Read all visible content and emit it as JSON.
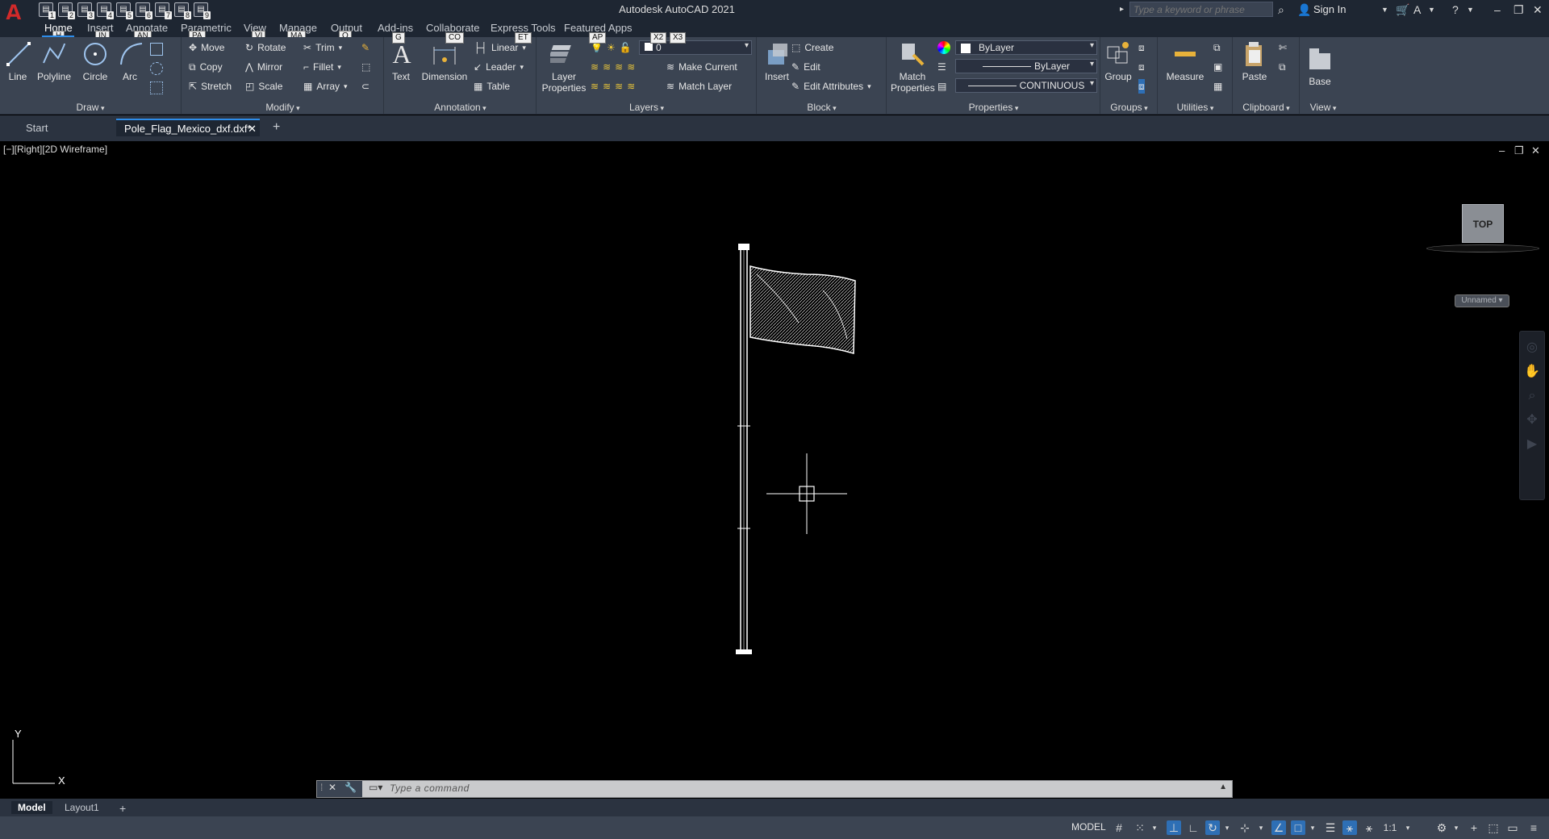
{
  "app": {
    "title": "Autodesk AutoCAD 2021",
    "logo": "A",
    "search_placeholder": "Type a keyword or phrase",
    "sign_in": "Sign In"
  },
  "qat": [
    {
      "glyph": "▤",
      "keytip": "1"
    },
    {
      "glyph": "▤",
      "keytip": "2"
    },
    {
      "glyph": "▤",
      "keytip": "3"
    },
    {
      "glyph": "▤",
      "keytip": "4"
    },
    {
      "glyph": "▤",
      "keytip": "5"
    },
    {
      "glyph": "▤",
      "keytip": "6"
    },
    {
      "glyph": "▤",
      "keytip": "7"
    },
    {
      "glyph": "▤",
      "keytip": "8"
    },
    {
      "glyph": "▤",
      "keytip": "9"
    }
  ],
  "ribbon_tabs": [
    {
      "label": "Home",
      "keytip": "H"
    },
    {
      "label": "Insert",
      "keytip": "IN"
    },
    {
      "label": "Annotate",
      "keytip": "AN"
    },
    {
      "label": "Parametric",
      "keytip": "PA"
    },
    {
      "label": "View",
      "keytip": "VI"
    },
    {
      "label": "Manage",
      "keytip": "MA"
    },
    {
      "label": "Output",
      "keytip": "O"
    },
    {
      "label": "Add-ins",
      "keytip": ""
    },
    {
      "label": "Collaborate",
      "keytip": ""
    },
    {
      "label": "Express Tools",
      "keytip": ""
    },
    {
      "label": "Featured Apps",
      "keytip": ""
    }
  ],
  "keytips_extra": {
    "g": "G",
    "co": "CO",
    "et": "ET",
    "ap": "AP",
    "x2": "X2",
    "x3": "X3"
  },
  "panels": {
    "draw": {
      "title": "Draw",
      "line": "Line",
      "polyline": "Polyline",
      "circle": "Circle",
      "arc": "Arc"
    },
    "modify": {
      "title": "Modify",
      "move": "Move",
      "rotate": "Rotate",
      "trim": "Trim",
      "copy": "Copy",
      "mirror": "Mirror",
      "fillet": "Fillet",
      "stretch": "Stretch",
      "scale": "Scale",
      "array": "Array"
    },
    "annotation": {
      "title": "Annotation",
      "text": "Text",
      "dimension": "Dimension",
      "linear": "Linear",
      "leader": "Leader",
      "table": "Table"
    },
    "layers": {
      "title": "Layers",
      "layer_properties_1": "Layer",
      "layer_properties_2": "Properties",
      "layer_combo": "0",
      "make_current": "Make Current",
      "match_layer": "Match Layer"
    },
    "block": {
      "title": "Block",
      "insert": "Insert",
      "create": "Create",
      "edit": "Edit",
      "edit_attributes": "Edit Attributes"
    },
    "properties": {
      "title": "Properties",
      "match_1": "Match",
      "match_2": "Properties",
      "color": "ByLayer",
      "lineweight": "ByLayer",
      "linetype": "CONTINUOUS"
    },
    "groups": {
      "title": "Groups",
      "group": "Group"
    },
    "utilities": {
      "title": "Utilities",
      "measure": "Measure"
    },
    "clipboard": {
      "title": "Clipboard",
      "paste": "Paste"
    },
    "view": {
      "title": "View",
      "base": "Base"
    }
  },
  "doc_tabs": [
    {
      "label": "Start"
    },
    {
      "label": "Pole_Flag_Mexico_dxf.dxf*"
    }
  ],
  "viewport": {
    "label": "[−][Right][2D Wireframe]",
    "viewcube": "TOP",
    "ucs_name": "Unnamed",
    "axis_y": "Y",
    "axis_x": "X"
  },
  "command": {
    "placeholder": "Type  a  command"
  },
  "layout_tabs": [
    {
      "label": "Model"
    },
    {
      "label": "Layout1"
    }
  ],
  "status": {
    "model": "MODEL",
    "scale": "1:1"
  }
}
